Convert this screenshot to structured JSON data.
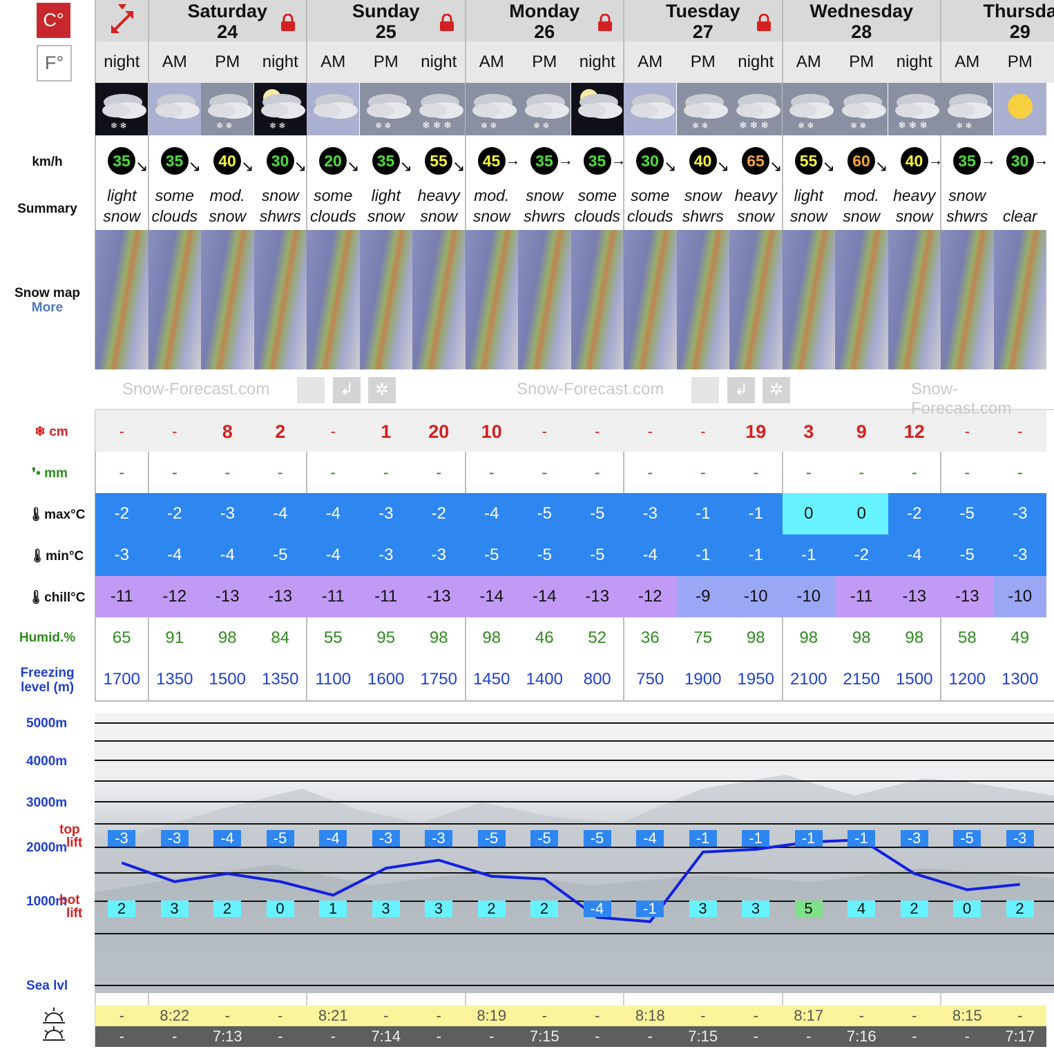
{
  "units": {
    "celsius": "C°",
    "fahrenheit": "F°"
  },
  "labels": {
    "wind": "km/h",
    "summary": "Summary",
    "snow_map": "Snow map",
    "snow_map_more": "More",
    "snow_cm": "cm",
    "rain_mm": "mm",
    "max": "max°C",
    "min": "min°C",
    "chill": "chill°C",
    "humid": "Humid.%",
    "freezing_1": "Freezing",
    "freezing_2": "level (m)",
    "lvl_5000": "5000m",
    "lvl_4000": "4000m",
    "lvl_3000": "3000m",
    "lvl_2000": "2000m",
    "lvl_1000": "1000m",
    "lvl_sea": "Sea lvl",
    "top_lift_1": "top",
    "top_lift_2": "lift",
    "bot_lift_1": "bot",
    "bot_lift_2": "lift"
  },
  "brand": {
    "watermark": "Snow-Forecast.com"
  },
  "days": [
    {
      "name": "Saturday",
      "num": "24"
    },
    {
      "name": "Sunday",
      "num": "25"
    },
    {
      "name": "Monday",
      "num": "26"
    },
    {
      "name": "Tuesday",
      "num": "27"
    },
    {
      "name": "Wednesday",
      "num": "28"
    },
    {
      "name": "Thursda",
      "num": "29"
    }
  ],
  "periods": [
    "night",
    "AM",
    "PM",
    "night",
    "AM",
    "PM",
    "night",
    "AM",
    "PM",
    "night",
    "AM",
    "PM",
    "night",
    "AM",
    "PM",
    "night",
    "AM",
    "PM"
  ],
  "icons": [
    "night-cloud-snow",
    "sun-cloud",
    "cloud-snow",
    "moon-cloud-snow",
    "sun-cloud",
    "cloud-snow",
    "cloud-heavy-snow",
    "cloud-snow",
    "sun-cloud-snow",
    "moon-cloud",
    "sun-cloud",
    "sun-cloud-snow",
    "cloud-heavy-snow",
    "cloud-snow",
    "cloud-snow",
    "cloud-heavy-snow",
    "sun-cloud-snow",
    "sun"
  ],
  "wind": [
    {
      "v": "35",
      "c": "#4dde3a",
      "dir": "↘"
    },
    {
      "v": "35",
      "c": "#4dde3a",
      "dir": "↘"
    },
    {
      "v": "40",
      "c": "#f5f53a",
      "dir": "↘"
    },
    {
      "v": "30",
      "c": "#4dde3a",
      "dir": "↘"
    },
    {
      "v": "20",
      "c": "#4dde3a",
      "dir": "↘"
    },
    {
      "v": "35",
      "c": "#4dde3a",
      "dir": "↘"
    },
    {
      "v": "55",
      "c": "#f5f53a",
      "dir": "↘"
    },
    {
      "v": "45",
      "c": "#f5f53a",
      "dir": "→"
    },
    {
      "v": "35",
      "c": "#4dde3a",
      "dir": "→"
    },
    {
      "v": "35",
      "c": "#4dde3a",
      "dir": "→"
    },
    {
      "v": "30",
      "c": "#4dde3a",
      "dir": "↘"
    },
    {
      "v": "40",
      "c": "#f5f53a",
      "dir": "↘"
    },
    {
      "v": "65",
      "c": "#f5a63a",
      "dir": "↘"
    },
    {
      "v": "55",
      "c": "#f5f53a",
      "dir": "↘"
    },
    {
      "v": "60",
      "c": "#f5a63a",
      "dir": "↘"
    },
    {
      "v": "40",
      "c": "#f5f53a",
      "dir": "→"
    },
    {
      "v": "35",
      "c": "#4dde3a",
      "dir": "→"
    },
    {
      "v": "30",
      "c": "#4dde3a",
      "dir": "→"
    }
  ],
  "summary": [
    [
      "light",
      "snow"
    ],
    [
      "some",
      "clouds"
    ],
    [
      "mod.",
      "snow"
    ],
    [
      "snow",
      "shwrs"
    ],
    [
      "some",
      "clouds"
    ],
    [
      "light",
      "snow"
    ],
    [
      "heavy",
      "snow"
    ],
    [
      "mod.",
      "snow"
    ],
    [
      "snow",
      "shwrs"
    ],
    [
      "some",
      "clouds"
    ],
    [
      "some",
      "clouds"
    ],
    [
      "snow",
      "shwrs"
    ],
    [
      "heavy",
      "snow"
    ],
    [
      "light",
      "snow"
    ],
    [
      "mod.",
      "snow"
    ],
    [
      "heavy",
      "snow"
    ],
    [
      "snow",
      "shwrs"
    ],
    [
      "",
      "clear"
    ]
  ],
  "snow_cm": [
    "-",
    "-",
    "8",
    "2",
    "-",
    "1",
    "20",
    "10",
    "-",
    "-",
    "-",
    "-",
    "19",
    "3",
    "9",
    "12",
    "-",
    "-"
  ],
  "rain_mm": [
    "-",
    "-",
    "-",
    "-",
    "-",
    "-",
    "-",
    "-",
    "-",
    "-",
    "-",
    "-",
    "-",
    "-",
    "-",
    "-",
    "-",
    "-"
  ],
  "max_c": [
    "-2",
    "-2",
    "-3",
    "-4",
    "-4",
    "-3",
    "-2",
    "-4",
    "-5",
    "-5",
    "-3",
    "-1",
    "-1",
    "0",
    "0",
    "-2",
    "-5",
    "-3"
  ],
  "min_c": [
    "-3",
    "-4",
    "-4",
    "-5",
    "-4",
    "-3",
    "-3",
    "-5",
    "-5",
    "-5",
    "-4",
    "-1",
    "-1",
    "-1",
    "-2",
    "-4",
    "-5",
    "-3"
  ],
  "chill_c": [
    "-11",
    "-12",
    "-13",
    "-13",
    "-11",
    "-11",
    "-13",
    "-14",
    "-14",
    "-13",
    "-12",
    "-9",
    "-10",
    "-10",
    "-11",
    "-13",
    "-13",
    "-10"
  ],
  "humid": [
    "65",
    "91",
    "98",
    "84",
    "55",
    "95",
    "98",
    "98",
    "46",
    "52",
    "36",
    "75",
    "98",
    "98",
    "98",
    "98",
    "58",
    "49"
  ],
  "freezing": [
    "1700",
    "1350",
    "1500",
    "1350",
    "1100",
    "1600",
    "1750",
    "1450",
    "1400",
    "800",
    "750",
    "1900",
    "1950",
    "2100",
    "2150",
    "1500",
    "1200",
    "1300"
  ],
  "top_lift": [
    "-3",
    "-3",
    "-4",
    "-5",
    "-4",
    "-3",
    "-3",
    "-5",
    "-5",
    "-5",
    "-4",
    "-1",
    "-1",
    "-1",
    "-1",
    "-3",
    "-5",
    "-3"
  ],
  "bot_lift": [
    "2",
    "3",
    "2",
    "0",
    "1",
    "3",
    "3",
    "2",
    "2",
    "-4",
    "-1",
    "3",
    "3",
    "5",
    "4",
    "2",
    "0",
    "2"
  ],
  "sunrise": [
    "-",
    "8:22",
    "-",
    "-",
    "8:21",
    "-",
    "-",
    "8:19",
    "-",
    "-",
    "8:18",
    "-",
    "-",
    "8:17",
    "-",
    "-",
    "8:15",
    "-"
  ],
  "sunset": [
    "-",
    "-",
    "7:13",
    "-",
    "-",
    "7:14",
    "-",
    "-",
    "7:15",
    "-",
    "-",
    "7:15",
    "-",
    "-",
    "7:16",
    "-",
    "-",
    "7:17"
  ],
  "colors": {
    "snow_red": "#d42020",
    "rain_green": "#2e8b1e",
    "temp_blue": "#2e86f0",
    "temp_cyan": "#66f2ff",
    "chill_purple": "#c09af5",
    "chill_blue": "#9aa7f5",
    "freeze_blue": "#1e3fd0",
    "sunrise_yellow": "#fbf49a",
    "sunset_gray": "#5e5e5e"
  }
}
